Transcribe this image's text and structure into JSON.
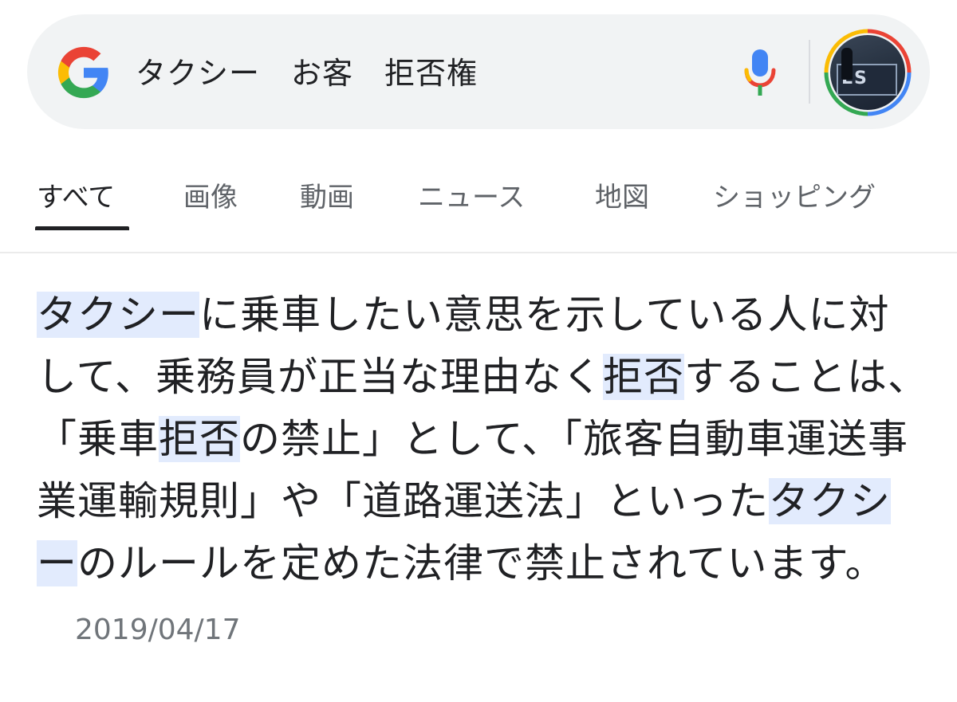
{
  "search": {
    "query": "タクシー　お客　拒否権"
  },
  "tabs": [
    {
      "label": "すべて",
      "active": true
    },
    {
      "label": "画像",
      "active": false
    },
    {
      "label": "動画",
      "active": false
    },
    {
      "label": "ニュース",
      "active": false
    },
    {
      "label": "地図",
      "active": false
    },
    {
      "label": "ショッピング",
      "active": false
    }
  ],
  "snippet": {
    "segments": [
      {
        "text": "タクシー",
        "highlight": true
      },
      {
        "text": "に乗車したい意思を示している人に対して、乗務員が正当な理由なく",
        "highlight": false
      },
      {
        "text": "拒否",
        "highlight": true
      },
      {
        "text": "することは、「乗車",
        "highlight": false
      },
      {
        "text": "拒否",
        "highlight": true
      },
      {
        "text": "の禁止」として、「旅客自動車運送事業運輸規則」や「道路運送法」といった",
        "highlight": false
      },
      {
        "text": "タクシー",
        "highlight": true
      },
      {
        "text": "のルールを定めた法律で禁止されています。",
        "highlight": false
      }
    ],
    "date": "2019/04/17"
  },
  "avatar": {
    "photo_text": "ES"
  },
  "colors": {
    "search_bg": "#f1f3f4",
    "highlight_bg": "#e2ebfd",
    "text_primary": "#202124",
    "text_secondary": "#5f6368",
    "google_blue": "#4285f4",
    "google_red": "#ea4335",
    "google_yellow": "#fbbc05",
    "google_green": "#34a853"
  },
  "icons": {
    "logo": "google-g-icon",
    "voice": "microphone-icon",
    "account": "account-avatar"
  }
}
